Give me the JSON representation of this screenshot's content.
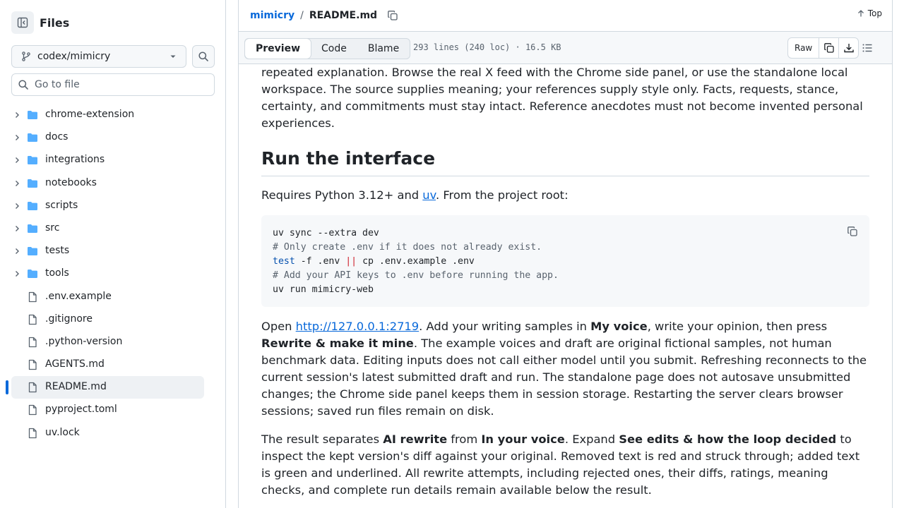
{
  "sidebar": {
    "title": "Files",
    "branch": "codex/mimicry",
    "goto_placeholder": "Go to file",
    "items": [
      {
        "name": "chrome-extension",
        "type": "folder"
      },
      {
        "name": "docs",
        "type": "folder"
      },
      {
        "name": "integrations",
        "type": "folder"
      },
      {
        "name": "notebooks",
        "type": "folder"
      },
      {
        "name": "scripts",
        "type": "folder"
      },
      {
        "name": "src",
        "type": "folder"
      },
      {
        "name": "tests",
        "type": "folder"
      },
      {
        "name": "tools",
        "type": "folder"
      },
      {
        "name": ".env.example",
        "type": "file"
      },
      {
        "name": ".gitignore",
        "type": "file"
      },
      {
        "name": ".python-version",
        "type": "file"
      },
      {
        "name": "AGENTS.md",
        "type": "file"
      },
      {
        "name": "README.md",
        "type": "file",
        "selected": true
      },
      {
        "name": "pyproject.toml",
        "type": "file"
      },
      {
        "name": "uv.lock",
        "type": "file"
      }
    ]
  },
  "header": {
    "repo": "mimicry",
    "separator": "/",
    "file": "README.md",
    "top_label": "Top"
  },
  "toolbar": {
    "tabs": [
      "Preview",
      "Code",
      "Blame"
    ],
    "active_tab": "Preview",
    "meta": "293 lines (240 loc) · 16.5 KB",
    "raw_label": "Raw"
  },
  "readme": {
    "intro": "repeated explanation. Browse the real X feed with the Chrome side panel, or use the standalone local workspace. The source supplies meaning; your references supply style only. Facts, requests, stance, certainty, and commitments must stay intact. Reference anecdotes must not become invented personal experiences.",
    "heading": "Run the interface",
    "req_before": "Requires Python 3.12+ and ",
    "req_link": "uv",
    "req_after": ". From the project root:",
    "code": {
      "l1": "uv sync --extra dev",
      "l2": "# Only create .env if it does not already exist.",
      "l3_kw": "test",
      "l3_a": " -f .env ",
      "l3_op": "||",
      "l3_b": " cp .env.example .env",
      "l4": "# Add your API keys to .env before running the app.",
      "l5": "uv run mimicry-web"
    },
    "p3_open": "Open ",
    "p3_link": "http://127.0.0.1:2719",
    "p3_a": ". Add your writing samples in ",
    "p3_b1": "My voice",
    "p3_c": ", write your opinion, then press ",
    "p3_b2": "Rewrite & make it mine",
    "p3_d": ". The example voices and draft are original fictional samples, not human benchmark data. Editing inputs does not call either model until you submit. Refreshing reconnects to the current session's latest submitted draft and run. The standalone page does not autosave unsubmitted changes; the Chrome side panel keeps them in session storage. Restarting the server clears browser sessions; saved run files remain on disk.",
    "p4_a": "The result separates ",
    "p4_b1": "AI rewrite",
    "p4_c": " from ",
    "p4_b2": "In your voice",
    "p4_d": ". Expand ",
    "p4_b3": "See edits & how the loop decided",
    "p4_e": " to inspect the kept version's diff against your original. Removed text is red and struck through; added text is green and underlined. All rewrite attempts, including rejected ones, their diffs, ratings, meaning checks, and complete run details remain available below the result."
  },
  "colors": {
    "accent": "#0969da",
    "folder": "#54aeff",
    "border": "#d1d9e0",
    "muted": "#59636e"
  }
}
